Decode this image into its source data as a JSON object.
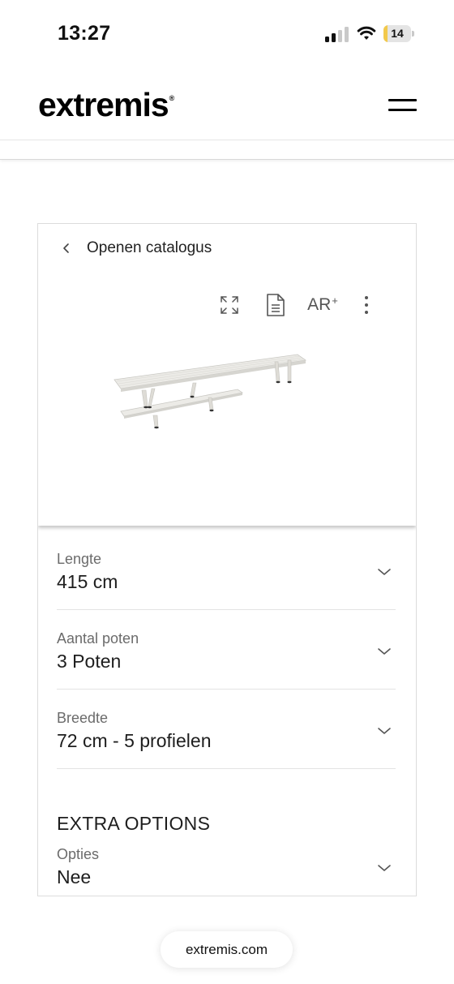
{
  "status_bar": {
    "time": "13:27",
    "battery_level": "14",
    "battery_fraction": 0.14,
    "signal_bars_active": 2,
    "signal_bars_total": 4
  },
  "header": {
    "logo_text": "extremis",
    "logo_mark": "®",
    "menu_icon": "hamburger-icon"
  },
  "configurator": {
    "back_label": "Openen catalogus",
    "toolbar": {
      "fullscreen_icon": "expand-icon",
      "document_icon": "document-icon",
      "ar_label": "AR",
      "ar_superscript": "+",
      "more_icon": "more-vertical-icon"
    },
    "product_image": "picnic-table-with-bench",
    "options": [
      {
        "label": "Lengte",
        "value": "415 cm"
      },
      {
        "label": "Aantal poten",
        "value": "3 Poten"
      },
      {
        "label": "Breedte",
        "value": "72 cm - 5 profielen"
      }
    ],
    "extra_title": "EXTRA OPTIONS",
    "extra_option": {
      "label": "Opties",
      "value": "Nee"
    }
  },
  "browser": {
    "url": "extremis.com"
  }
}
